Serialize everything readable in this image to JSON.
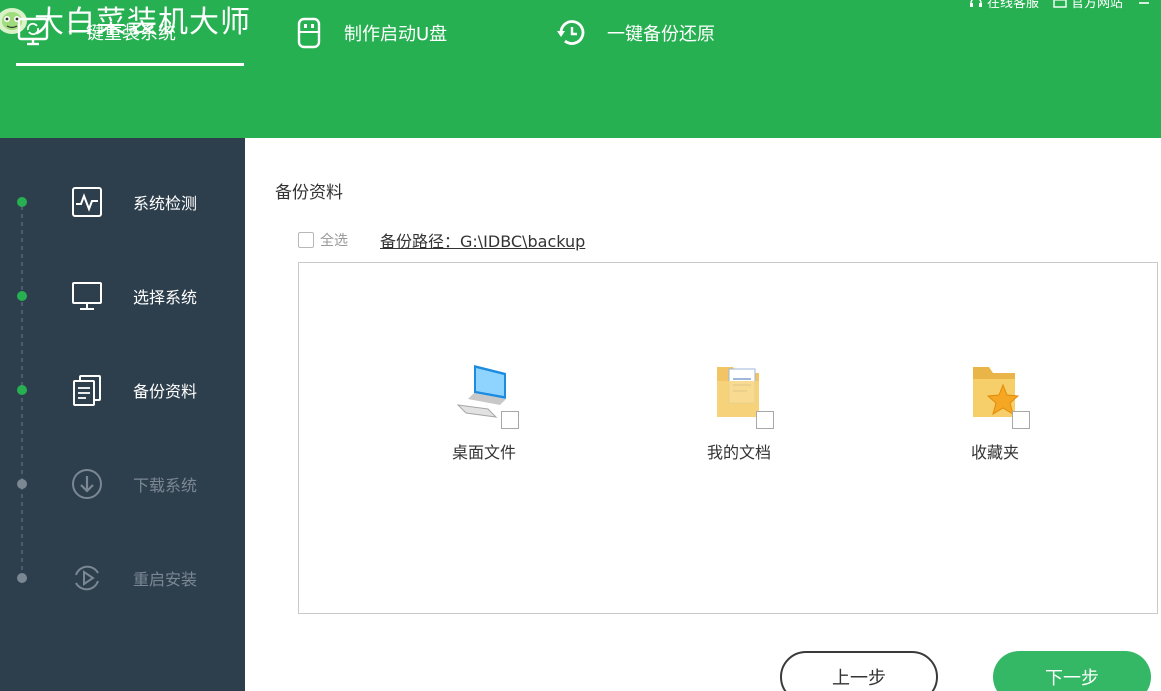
{
  "app": {
    "title": "大白菜装机大师"
  },
  "top_links": {
    "support": "在线客服",
    "website": "官方网站"
  },
  "tabs": [
    {
      "label": "一键重装系统",
      "icon": "monitor-refresh-icon",
      "active": true
    },
    {
      "label": "制作启动U盘",
      "icon": "usb-drive-icon",
      "active": false
    },
    {
      "label": "一键备份还原",
      "icon": "backup-restore-icon",
      "active": false
    }
  ],
  "steps": [
    {
      "label": "系统检测",
      "icon": "pulse-monitor-icon",
      "status": "done"
    },
    {
      "label": "选择系统",
      "icon": "desktop-icon",
      "status": "done"
    },
    {
      "label": "备份资料",
      "icon": "documents-icon",
      "status": "done"
    },
    {
      "label": "下载系统",
      "icon": "download-icon",
      "status": "todo"
    },
    {
      "label": "重启安装",
      "icon": "restart-icon",
      "status": "todo"
    }
  ],
  "main": {
    "section_title": "备份资料",
    "select_all": "全选",
    "backup_path": "备份路径：G:\\IDBC\\backup",
    "files": [
      {
        "label": "桌面文件",
        "icon": "computer-icon"
      },
      {
        "label": "我的文档",
        "icon": "document-folder-icon"
      },
      {
        "label": "收藏夹",
        "icon": "favorites-folder-icon"
      }
    ]
  },
  "buttons": {
    "prev": "上一步",
    "next": "下一步"
  },
  "colors": {
    "brand_green": "#27b052",
    "sidebar_bg": "#2d3e4c",
    "inactive": "#7b8894"
  }
}
